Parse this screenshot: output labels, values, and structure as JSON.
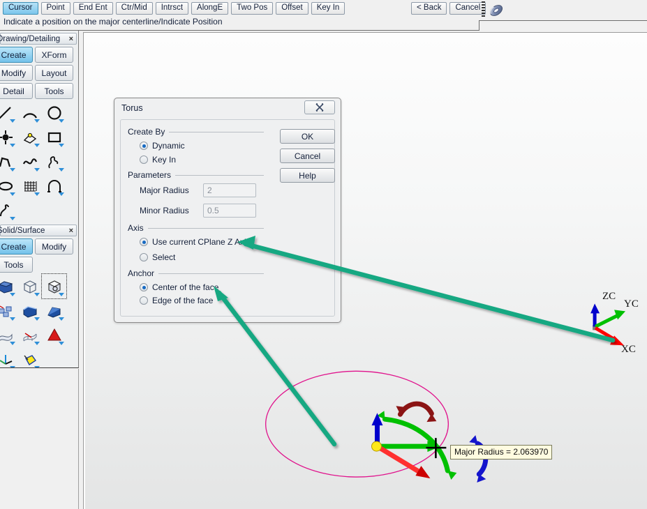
{
  "topbar": {
    "snap_buttons": [
      {
        "label": "Cursor",
        "active": true
      },
      {
        "label": "Point",
        "active": false
      },
      {
        "label": "End Ent",
        "active": false
      },
      {
        "label": "Ctr/Mid",
        "active": false
      },
      {
        "label": "Intrsct",
        "active": false
      },
      {
        "label": "AlongE",
        "active": false
      },
      {
        "label": "Two Pos",
        "active": false
      },
      {
        "label": "Offset",
        "active": false
      },
      {
        "label": "Key In",
        "active": false
      }
    ],
    "prompt": "Indicate a position on the major centerline/Indicate Position",
    "nav_buttons": [
      {
        "label": "< Back"
      },
      {
        "label": "Cancel"
      }
    ],
    "app_icon": "torus-icon",
    "grip": "drag-grip"
  },
  "left_dock": {
    "panels": [
      {
        "title": "Drawing/Detailing",
        "close_label": "×",
        "tabs": [
          {
            "label": "Create",
            "active": true
          },
          {
            "label": "XForm",
            "active": false
          },
          {
            "label": "Modify",
            "active": false
          },
          {
            "label": "Layout",
            "active": false
          },
          {
            "label": "Detail",
            "active": false
          },
          {
            "label": "Tools",
            "active": false
          }
        ],
        "tool_icons": [
          "line-icon",
          "arc-icon",
          "circle-icon",
          "point-icon",
          "sketch-icon",
          "rectangle-icon",
          "polyline-icon",
          "spline-icon",
          "freeform-curve-icon",
          "ellipse-icon",
          "grid-curve-icon",
          "fillet-arc-icon",
          "chamfer-icon"
        ]
      },
      {
        "title": "Solid/Surface",
        "close_label": "×",
        "tabs": [
          {
            "label": "Create",
            "active": true
          },
          {
            "label": "Modify",
            "active": false
          },
          {
            "label": "Tools",
            "active": false
          }
        ],
        "tool_icons": [
          "block-solid-icon",
          "wireframe-box-icon",
          "primitive-solid-icon",
          "solid-array-icon",
          "extrude-solid-icon",
          "wedge-solid-icon",
          "sheet-surface-icon",
          "ruled-surface-icon",
          "cone-solid-icon",
          "axis-triad-icon",
          "face-select-icon"
        ]
      }
    ]
  },
  "dialog": {
    "title": "Torus",
    "close_icon": "close-icon",
    "groups": {
      "create_by": {
        "header": "Create By",
        "options": [
          {
            "label": "Dynamic",
            "selected": true
          },
          {
            "label": "Key In",
            "selected": false
          }
        ]
      },
      "parameters": {
        "header": "Parameters",
        "fields": [
          {
            "label": "Major Radius",
            "value": "2",
            "placeholder": "2",
            "disabled": true
          },
          {
            "label": "Minor Radius",
            "value": "0.5",
            "placeholder": "0.5",
            "disabled": true
          }
        ]
      },
      "axis": {
        "header": "Axis",
        "options": [
          {
            "label": "Use current CPlane Z Axis",
            "selected": true
          },
          {
            "label": "Select",
            "selected": false
          }
        ]
      },
      "anchor": {
        "header": "Anchor",
        "options": [
          {
            "label": "Center of the face",
            "selected": true
          },
          {
            "label": "Edge of the face",
            "selected": false
          }
        ]
      }
    },
    "buttons": [
      {
        "label": "OK"
      },
      {
        "label": "Cancel"
      },
      {
        "label": "Help"
      }
    ]
  },
  "viewport": {
    "tooltip": "Major Radius = 2.063970",
    "cursor": "crosshair-cursor",
    "preview_circle": "major-radius-preview-circle",
    "manipulator": "dynamic-move-manipulator",
    "wcs_triad": {
      "z_label": "ZC",
      "y_label": "YC",
      "x_label": "XC"
    }
  },
  "annotations": {
    "arrows": [
      {
        "name": "arrow-to-axis-option"
      },
      {
        "name": "arrow-to-anchor-option"
      }
    ]
  },
  "colors": {
    "accent_blue": "#74c2ea",
    "annotation_teal": "#16a882",
    "preview_magenta": "#e0128c",
    "axis_x_red": "#ff0000",
    "axis_y_green": "#00c000",
    "axis_z_blue": "#0000cc",
    "tooltip_bg": "#fffbe0",
    "dialog_bg": "#eff0f1"
  }
}
